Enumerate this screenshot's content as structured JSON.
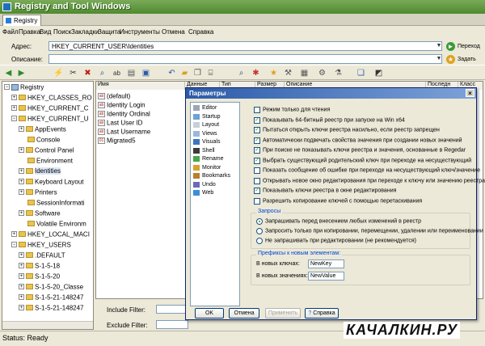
{
  "window": {
    "title": "Registry and Tool Windows"
  },
  "tabs": [
    {
      "label": "Registry"
    }
  ],
  "menu": [
    "Файл",
    "Правка",
    "Вид",
    "Поиск",
    "Закладки",
    "Защита",
    "Инструменты",
    "Отмена",
    "Справка"
  ],
  "address": {
    "label": "Адрес:",
    "value": "HKEY_CURRENT_USER\\Identities",
    "go_label": "Переход"
  },
  "description": {
    "label": "Описание:",
    "value": "",
    "go_label": "Задать"
  },
  "toolbar": {
    "icons": [
      "back-icon",
      "forward-icon",
      "connect-icon",
      "cut-icon",
      "delete-icon",
      "find-icon",
      "rename-icon",
      "paste-icon",
      "save-icon",
      "undo-icon",
      "open-folder-icon",
      "copy-icon",
      "search-icon",
      "zoom-icon",
      "bookmark-icon",
      "favorites-icon",
      "tools-icon",
      "monitor-icon",
      "filter-icon",
      "network-icon",
      "window-icon",
      "settings-icon"
    ]
  },
  "tree": {
    "items": [
      {
        "label": "Registry",
        "exp": "−",
        "kind": "pc",
        "level": 0
      },
      {
        "label": "HKEY_CLASSES_RO",
        "exp": "+",
        "kind": "folder",
        "level": 1
      },
      {
        "label": "HKEY_CURRENT_C",
        "exp": "+",
        "kind": "folder",
        "level": 1
      },
      {
        "label": "HKEY_CURRENT_U",
        "exp": "−",
        "kind": "folder",
        "level": 1
      },
      {
        "label": "AppEvents",
        "exp": "+",
        "kind": "folder",
        "level": 2
      },
      {
        "label": "Console",
        "exp": "",
        "kind": "folder",
        "level": 2
      },
      {
        "label": "Control Panel",
        "exp": "+",
        "kind": "folder",
        "level": 2
      },
      {
        "label": "Environment",
        "exp": "",
        "kind": "folder",
        "level": 2
      },
      {
        "label": "Identities",
        "exp": "+",
        "kind": "folder",
        "level": 2,
        "selected": true
      },
      {
        "label": "Keyboard Layout",
        "exp": "+",
        "kind": "folder",
        "level": 2
      },
      {
        "label": "Printers",
        "exp": "+",
        "kind": "folder",
        "level": 2
      },
      {
        "label": "SessionInformati",
        "exp": "",
        "kind": "folder",
        "level": 2
      },
      {
        "label": "Software",
        "exp": "+",
        "kind": "folder",
        "level": 2
      },
      {
        "label": "Volatile Environm",
        "exp": "",
        "kind": "folder",
        "level": 2
      },
      {
        "label": "HKEY_LOCAL_MACI",
        "exp": "+",
        "kind": "folder",
        "level": 1
      },
      {
        "label": "HKEY_USERS",
        "exp": "−",
        "kind": "folder",
        "level": 1
      },
      {
        "label": ".DEFAULT",
        "exp": "+",
        "kind": "folder",
        "level": 2
      },
      {
        "label": "S-1-5-18",
        "exp": "+",
        "kind": "folder",
        "level": 2
      },
      {
        "label": "S-1-5-20",
        "exp": "+",
        "kind": "folder",
        "level": 2
      },
      {
        "label": "S-1-5-20_Classe",
        "exp": "+",
        "kind": "folder",
        "level": 2
      },
      {
        "label": "S-1-5-21-148247",
        "exp": "+",
        "kind": "folder",
        "level": 2
      },
      {
        "label": "S-1-5-21-148247",
        "exp": "+",
        "kind": "folder",
        "level": 2
      }
    ]
  },
  "list": {
    "columns": [
      "Имя",
      "Данные",
      "Тип",
      "Размер",
      "Описание",
      "Последн",
      "Класс"
    ],
    "rows": [
      {
        "name": "(default)",
        "icon": "ab"
      },
      {
        "name": "Identity Login",
        "icon": "ab"
      },
      {
        "name": "Identity Ordinal",
        "icon": "ab"
      },
      {
        "name": "Last User ID",
        "icon": "ab"
      },
      {
        "name": "Last Username",
        "icon": "ab"
      },
      {
        "name": "Migrated5",
        "icon": "01"
      }
    ]
  },
  "filters": {
    "include_label": "Include Filter:",
    "exclude_label": "Exclude Filter:"
  },
  "status": {
    "text": "Status: Ready"
  },
  "dialog": {
    "title": "Параметры",
    "nav": [
      {
        "label": "Editor",
        "color": "#9aa6b8"
      },
      {
        "label": "Startup",
        "color": "#6fa0d8"
      },
      {
        "label": "Layout",
        "color": "#c9cfd9"
      },
      {
        "label": "Views",
        "color": "#9bb7db"
      },
      {
        "label": "Visuals",
        "color": "#3a75c4"
      },
      {
        "label": "Shell",
        "color": "#3c3c3c"
      },
      {
        "label": "Rename",
        "color": "#4aa64a"
      },
      {
        "label": "Monitor",
        "color": "#d9a22e"
      },
      {
        "label": "Bookmarks",
        "color": "#b8802a"
      },
      {
        "label": "Undo",
        "color": "#6a6ab8"
      },
      {
        "label": "Web",
        "color": "#3a8fd6"
      }
    ],
    "checks": [
      {
        "label": "Режим только для чтения",
        "checked": false
      },
      {
        "label": "Показывать 64-битный реестр при запуске на Win x64",
        "checked": true
      },
      {
        "label": "Пытаться открыть ключи реестра насильно, если реестр запрещен",
        "checked": true
      },
      {
        "label": "Автоматически подвечать свойства значения при создании новых значений",
        "checked": true
      },
      {
        "label": "При поиске не показывать ключи реестра и значения, основанные в Regedar",
        "checked": true
      },
      {
        "label": "Выбрать существующий родительский ключ при переходе на несуществующий",
        "checked": true
      },
      {
        "label": "Показать сообщение об ошибке при переходе на несуществующий ключ/значение",
        "checked": false
      },
      {
        "label": "Открывать новое окно редактирования при переходе к ключу или значению реестра",
        "checked": false
      },
      {
        "label": "Показывать ключи реестра в окне редактирования",
        "checked": true
      },
      {
        "label": "Разрешить копирование ключей с помощью перетаскивания",
        "checked": false
      }
    ],
    "requests": {
      "title": "Запросы",
      "options": [
        {
          "label": "Запрашивать перед внесением любых изменений в реестр",
          "selected": true
        },
        {
          "label": "Запросить только при копировании, перемещении, удалении или переименовании",
          "selected": false
        },
        {
          "label": "Не запрашивать при редактировании (не рекомендуется)",
          "selected": false
        }
      ]
    },
    "prefixes": {
      "title": "Префиксы к новым элементам:",
      "key_label": "В новых ключах:",
      "key_value": "NewKey",
      "value_label": "В новых значениях:",
      "value_value": "NewValue"
    },
    "buttons": {
      "ok": "OK",
      "cancel": "Отмена",
      "apply": "Применить",
      "help": "Справка"
    }
  },
  "watermark": "КАЧАЛКИН.РУ"
}
